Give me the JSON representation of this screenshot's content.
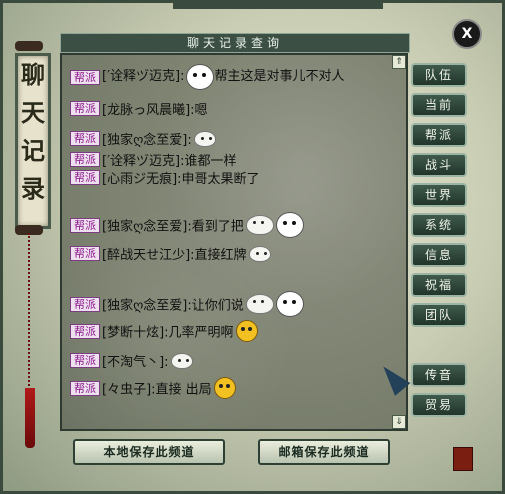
{
  "window": {
    "title": "聊天记录查询",
    "close_label": "X",
    "scroll_title": [
      "聊",
      "天",
      "记",
      "录"
    ]
  },
  "chat": {
    "lines": [
      {
        "tag": "帮派",
        "text": "[′诠释ヅ迈克]:",
        "suffix": "帮主这是对事儿不对人",
        "emotes": [
          "bigbun-icon"
        ]
      },
      {
        "tag": "帮派",
        "text": "[龙脉っ风晨曦]:嗯",
        "suffix": "",
        "emotes": []
      },
      {
        "tag": "帮派",
        "text": "[独家ღ念至爱]:",
        "suffix": "",
        "emotes": [
          "bun-icon"
        ]
      },
      {
        "tag": "帮派",
        "text": "[′诠释ヅ迈克]:谁都一样",
        "suffix": "",
        "emotes": []
      },
      {
        "tag": "帮派",
        "text": "[心雨ジ无痕]:申哥太果断了",
        "suffix": "",
        "emotes": []
      },
      {
        "tag": "帮派",
        "text": "[独家ღ念至爱]:看到了把",
        "suffix": "",
        "emotes": [
          "bun-icon",
          "bigbun-icon"
        ]
      },
      {
        "tag": "帮派",
        "text": "[醉战天せ江少]:直接红牌",
        "suffix": "",
        "emotes": [
          "bun-icon"
        ]
      },
      {
        "tag": "帮派",
        "text": "[独家ღ念至爱]:让你们说",
        "suffix": "",
        "emotes": [
          "bun-icon",
          "bigbun-icon"
        ]
      },
      {
        "tag": "帮派",
        "text": "[梦断十炫]:几率严明啊",
        "suffix": "",
        "emotes": [
          "face-icon"
        ]
      },
      {
        "tag": "帮派",
        "text": "[不淘气丶]:",
        "suffix": "",
        "emotes": [
          "bun-icon"
        ]
      },
      {
        "tag": "帮派",
        "text": "[々虫子]:直接 出局",
        "suffix": "",
        "emotes": [
          "face-icon"
        ]
      }
    ]
  },
  "sidebar": {
    "buttons": [
      "队伍",
      "当前",
      "帮派",
      "战斗",
      "世界",
      "系统",
      "信息",
      "祝福",
      "团队",
      "传音",
      "贸易"
    ]
  },
  "footer": {
    "local_save": "本地保存此频道",
    "mail_save": "邮箱保存此频道"
  },
  "colors": {
    "tag_text": "#8a1a8a",
    "panel_border": "#2e3a30",
    "button_fill": "#22352b"
  }
}
